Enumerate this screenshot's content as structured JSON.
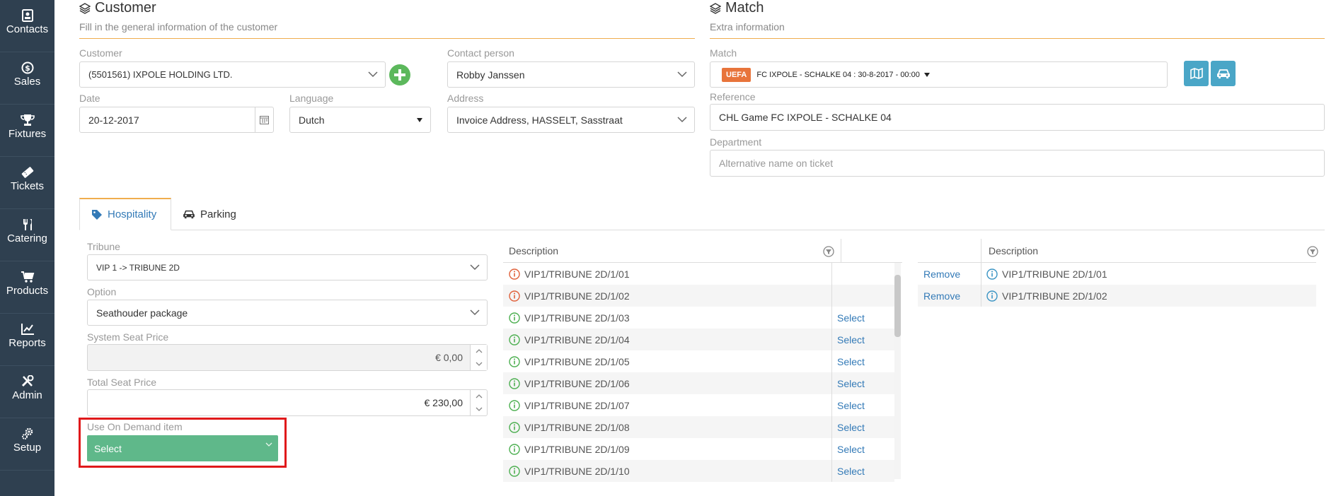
{
  "nav": [
    {
      "label": "Contacts",
      "icon": "contact-card-icon"
    },
    {
      "label": "Sales",
      "icon": "dollar-icon"
    },
    {
      "label": "Fixtures",
      "icon": "trophy-icon"
    },
    {
      "label": "Tickets",
      "icon": "ticket-icon"
    },
    {
      "label": "Catering",
      "icon": "cutlery-icon"
    },
    {
      "label": "Products",
      "icon": "cart-icon"
    },
    {
      "label": "Reports",
      "icon": "chart-icon"
    },
    {
      "label": "Admin",
      "icon": "tools-icon"
    },
    {
      "label": "Setup",
      "icon": "gears-icon"
    }
  ],
  "customer": {
    "title": "Customer",
    "subtitle": "Fill in the general information of the customer",
    "customer_label": "Customer",
    "customer_value": "(5501561) IXPOLE HOLDING LTD.",
    "contact_label": "Contact person",
    "contact_value": "Robby Janssen",
    "date_label": "Date",
    "date_value": "20-12-2017",
    "language_label": "Language",
    "language_value": "Dutch",
    "address_label": "Address",
    "address_value": "Invoice Address, HASSELT, Sasstraat"
  },
  "match": {
    "title": "Match",
    "subtitle": "Extra information",
    "match_label": "Match",
    "badge": "UEFA",
    "match_value": "FC IXPOLE - SCHALKE 04 : 30-8-2017 - 00:00",
    "reference_label": "Reference",
    "reference_value": "CHL Game FC IXPOLE - SCHALKE 04",
    "department_label": "Department",
    "department_placeholder": "Alternative name on ticket"
  },
  "tabs": [
    {
      "label": "Hospitality"
    },
    {
      "label": "Parking"
    }
  ],
  "form": {
    "tribune_label": "Tribune",
    "tribune_value": "VIP 1 -> TRIBUNE 2D",
    "option_label": "Option",
    "option_value": "Seathouder package",
    "system_price_label": "System Seat Price",
    "system_price_value": "€ 0,00",
    "total_price_label": "Total Seat Price",
    "total_price_value": "€ 230,00",
    "on_demand_label": "Use On Demand item",
    "on_demand_value": "Select"
  },
  "available": {
    "header": "Description",
    "action_label": "Select",
    "rows": [
      {
        "desc": "VIP1/TRIBUNE 2D/1/01",
        "status": "unavailable"
      },
      {
        "desc": "VIP1/TRIBUNE 2D/1/02",
        "status": "unavailable"
      },
      {
        "desc": "VIP1/TRIBUNE 2D/1/03",
        "status": "available"
      },
      {
        "desc": "VIP1/TRIBUNE 2D/1/04",
        "status": "available"
      },
      {
        "desc": "VIP1/TRIBUNE 2D/1/05",
        "status": "available"
      },
      {
        "desc": "VIP1/TRIBUNE 2D/1/06",
        "status": "available"
      },
      {
        "desc": "VIP1/TRIBUNE 2D/1/07",
        "status": "available"
      },
      {
        "desc": "VIP1/TRIBUNE 2D/1/08",
        "status": "available"
      },
      {
        "desc": "VIP1/TRIBUNE 2D/1/09",
        "status": "available"
      },
      {
        "desc": "VIP1/TRIBUNE 2D/1/10",
        "status": "available"
      }
    ]
  },
  "selected": {
    "header": "Description",
    "action_label": "Remove",
    "rows": [
      {
        "desc": "VIP1/TRIBUNE 2D/1/01"
      },
      {
        "desc": "VIP1/TRIBUNE 2D/1/02"
      }
    ]
  },
  "colors": {
    "sidebar": "#2f4050",
    "accent": "#f0ad4e",
    "link": "#337ab7",
    "green": "#5cb85c",
    "teal": "#4aa6c7",
    "badge": "#e8743b",
    "highlight": "#e0191b",
    "unavailable": "#e0603a",
    "available": "#4caf50",
    "info": "#3a94c4"
  }
}
